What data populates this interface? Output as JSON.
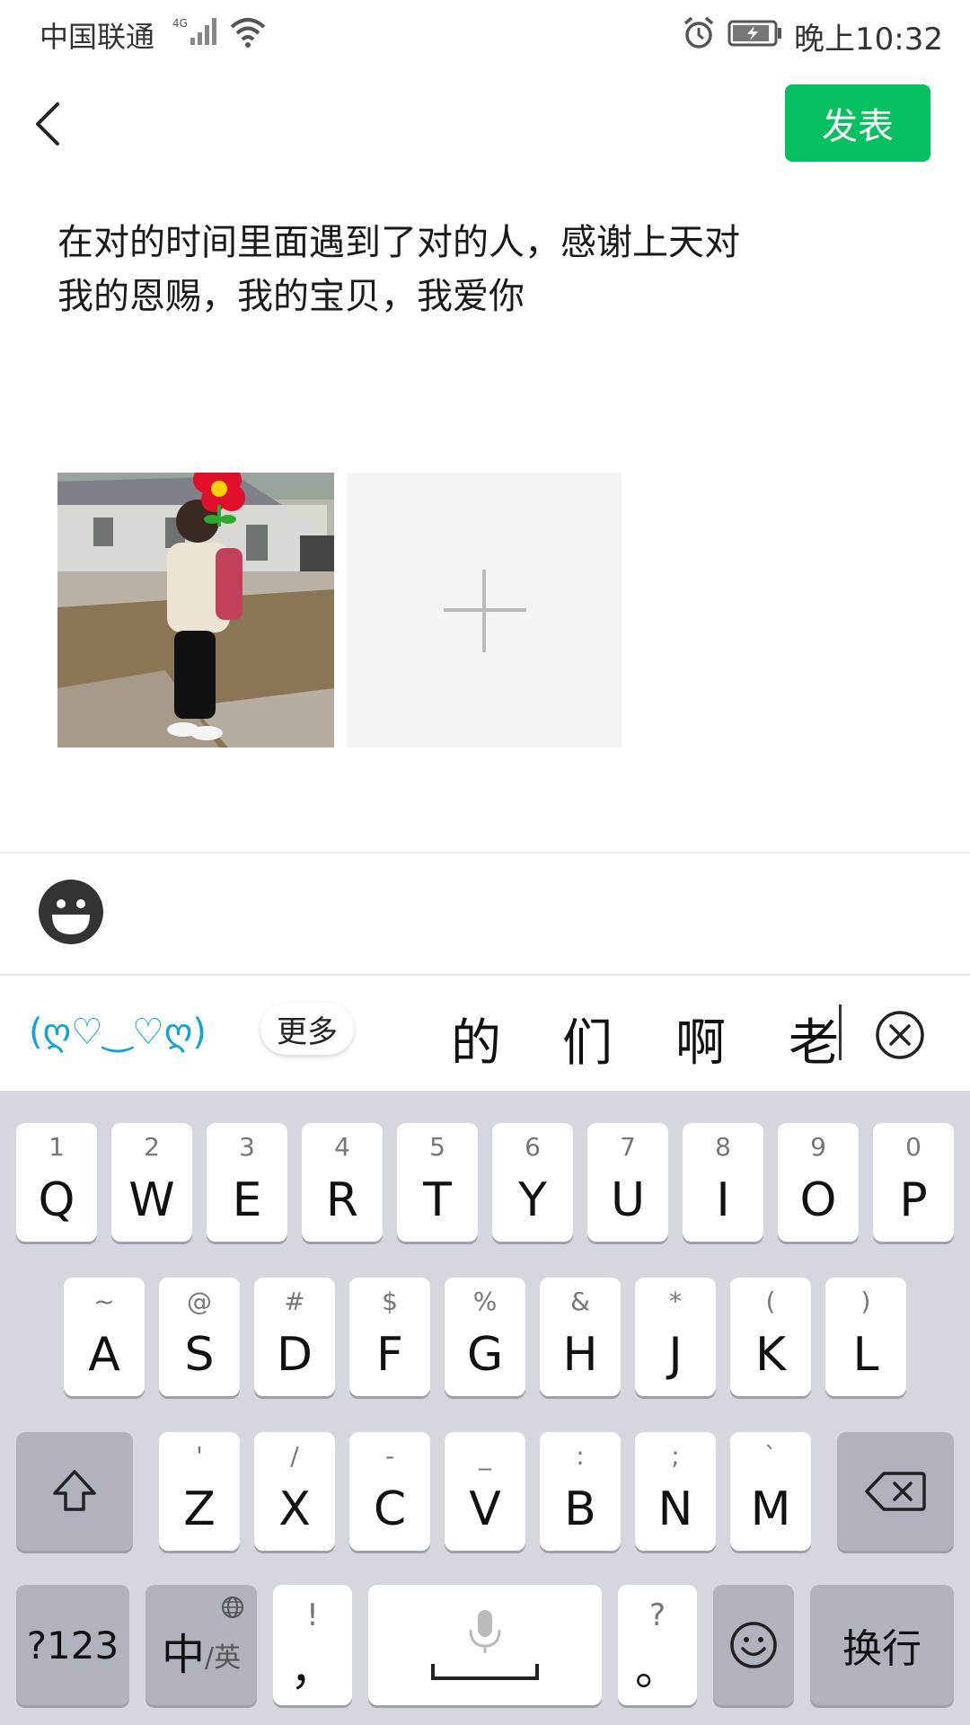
{
  "status_bar": {
    "carrier": "中国联通",
    "network": "4G",
    "time": "晚上10:32"
  },
  "header": {
    "publish_label": "发表"
  },
  "post": {
    "text_line1": "在对的时间里面遇到了对的人，感谢上天对",
    "text_line2": "我的恩赐，我的宝贝，我爱你"
  },
  "candidates": {
    "kaomoji": "(ღ♡‿♡ღ)",
    "more_label": "更多",
    "words": [
      "的",
      "们",
      "啊",
      "老"
    ]
  },
  "keyboard": {
    "row1": [
      {
        "main": "Q",
        "sub": "1"
      },
      {
        "main": "W",
        "sub": "2"
      },
      {
        "main": "E",
        "sub": "3"
      },
      {
        "main": "R",
        "sub": "4"
      },
      {
        "main": "T",
        "sub": "5"
      },
      {
        "main": "Y",
        "sub": "6"
      },
      {
        "main": "U",
        "sub": "7"
      },
      {
        "main": "I",
        "sub": "8"
      },
      {
        "main": "O",
        "sub": "9"
      },
      {
        "main": "P",
        "sub": "0"
      }
    ],
    "row2": [
      {
        "main": "A",
        "sub": "~"
      },
      {
        "main": "S",
        "sub": "@"
      },
      {
        "main": "D",
        "sub": "#"
      },
      {
        "main": "F",
        "sub": "$"
      },
      {
        "main": "G",
        "sub": "%"
      },
      {
        "main": "H",
        "sub": "&"
      },
      {
        "main": "J",
        "sub": "*"
      },
      {
        "main": "K",
        "sub": "("
      },
      {
        "main": "L",
        "sub": ")"
      }
    ],
    "row3": [
      {
        "main": "Z",
        "sub": "'"
      },
      {
        "main": "X",
        "sub": "/"
      },
      {
        "main": "C",
        "sub": "-"
      },
      {
        "main": "V",
        "sub": "_"
      },
      {
        "main": "B",
        "sub": ":"
      },
      {
        "main": "N",
        "sub": ";"
      },
      {
        "main": "M",
        "sub": "`"
      }
    ],
    "symbols_label": "?123",
    "lang_main": "中",
    "lang_sub": "/英",
    "comma_main": "，",
    "comma_sub": "!",
    "period_main": "。",
    "period_sub": "?",
    "enter_label": "换行"
  },
  "colors": {
    "accent": "#07c160",
    "kaomoji": "#12a4d6",
    "keyboard_bg": "#d4d7de"
  }
}
